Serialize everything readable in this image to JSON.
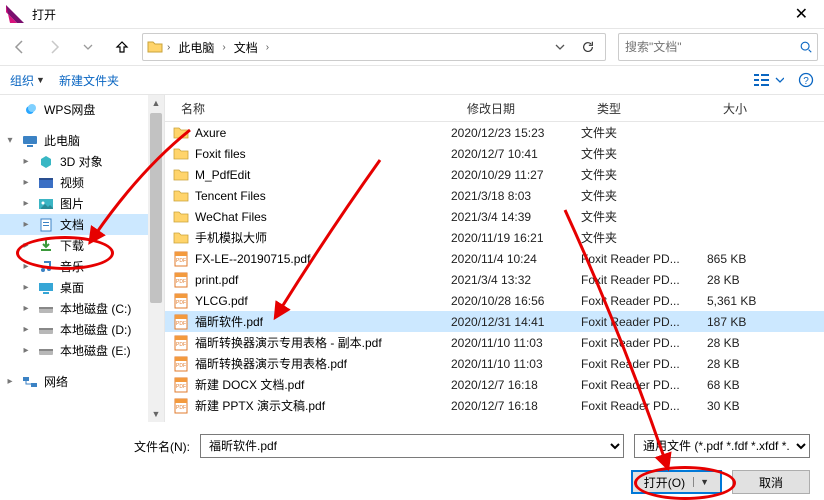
{
  "title": "打开",
  "breadcrumbs": {
    "pc": "此电脑",
    "docs": "文档"
  },
  "search": {
    "placeholder": "搜索\"文档\""
  },
  "toolbar": {
    "organize": "组织",
    "newfolder": "新建文件夹"
  },
  "sidebar": {
    "wps": "WPS网盘",
    "pc": "此电脑",
    "obj3d": "3D 对象",
    "video": "视频",
    "pictures": "图片",
    "documents": "文档",
    "downloads": "下载",
    "music": "音乐",
    "desktop": "桌面",
    "diskC": "本地磁盘 (C:)",
    "diskD": "本地磁盘 (D:)",
    "diskE": "本地磁盘 (E:)",
    "network": "网络"
  },
  "columns": {
    "name": "名称",
    "date": "修改日期",
    "type": "类型",
    "size": "大小"
  },
  "rows": [
    {
      "icon": "folder",
      "name": "Axure",
      "date": "2020/12/23 15:23",
      "type": "文件夹",
      "size": ""
    },
    {
      "icon": "folder",
      "name": "Foxit files",
      "date": "2020/12/7 10:41",
      "type": "文件夹",
      "size": ""
    },
    {
      "icon": "folder",
      "name": "M_PdfEdit",
      "date": "2020/10/29 11:27",
      "type": "文件夹",
      "size": ""
    },
    {
      "icon": "folder",
      "name": "Tencent Files",
      "date": "2021/3/18 8:03",
      "type": "文件夹",
      "size": ""
    },
    {
      "icon": "folder",
      "name": "WeChat Files",
      "date": "2021/3/4 14:39",
      "type": "文件夹",
      "size": ""
    },
    {
      "icon": "folder",
      "name": "手机模拟大师",
      "date": "2020/11/19 16:21",
      "type": "文件夹",
      "size": ""
    },
    {
      "icon": "pdf",
      "name": "FX-LE--20190715.pdf",
      "date": "2020/11/4 10:24",
      "type": "Foxit Reader PD...",
      "size": "865 KB"
    },
    {
      "icon": "pdf",
      "name": "print.pdf",
      "date": "2021/3/4 13:32",
      "type": "Foxit Reader PD...",
      "size": "28 KB"
    },
    {
      "icon": "pdf",
      "name": "YLCG.pdf",
      "date": "2020/10/28 16:56",
      "type": "Foxit Reader PD...",
      "size": "5,361 KB"
    },
    {
      "icon": "pdf",
      "name": "福昕软件.pdf",
      "date": "2020/12/31 14:41",
      "type": "Foxit Reader PD...",
      "size": "187 KB",
      "selected": true
    },
    {
      "icon": "pdf",
      "name": "福昕转换器演示专用表格 - 副本.pdf",
      "date": "2020/11/10 11:03",
      "type": "Foxit Reader PD...",
      "size": "28 KB"
    },
    {
      "icon": "pdf",
      "name": "福昕转换器演示专用表格.pdf",
      "date": "2020/11/10 11:03",
      "type": "Foxit Reader PD...",
      "size": "28 KB"
    },
    {
      "icon": "pdf",
      "name": "新建 DOCX 文档.pdf",
      "date": "2020/12/7 16:18",
      "type": "Foxit Reader PD...",
      "size": "68 KB"
    },
    {
      "icon": "pdf",
      "name": "新建 PPTX 演示文稿.pdf",
      "date": "2020/12/7 16:18",
      "type": "Foxit Reader PD...",
      "size": "30 KB"
    }
  ],
  "bottom": {
    "filename_lbl": "文件名(N):",
    "filename_val": "福昕软件.pdf",
    "filter_val": "通用文件 (*.pdf *.fdf *.xfdf *.x",
    "open": "打开(O)",
    "cancel": "取消"
  }
}
